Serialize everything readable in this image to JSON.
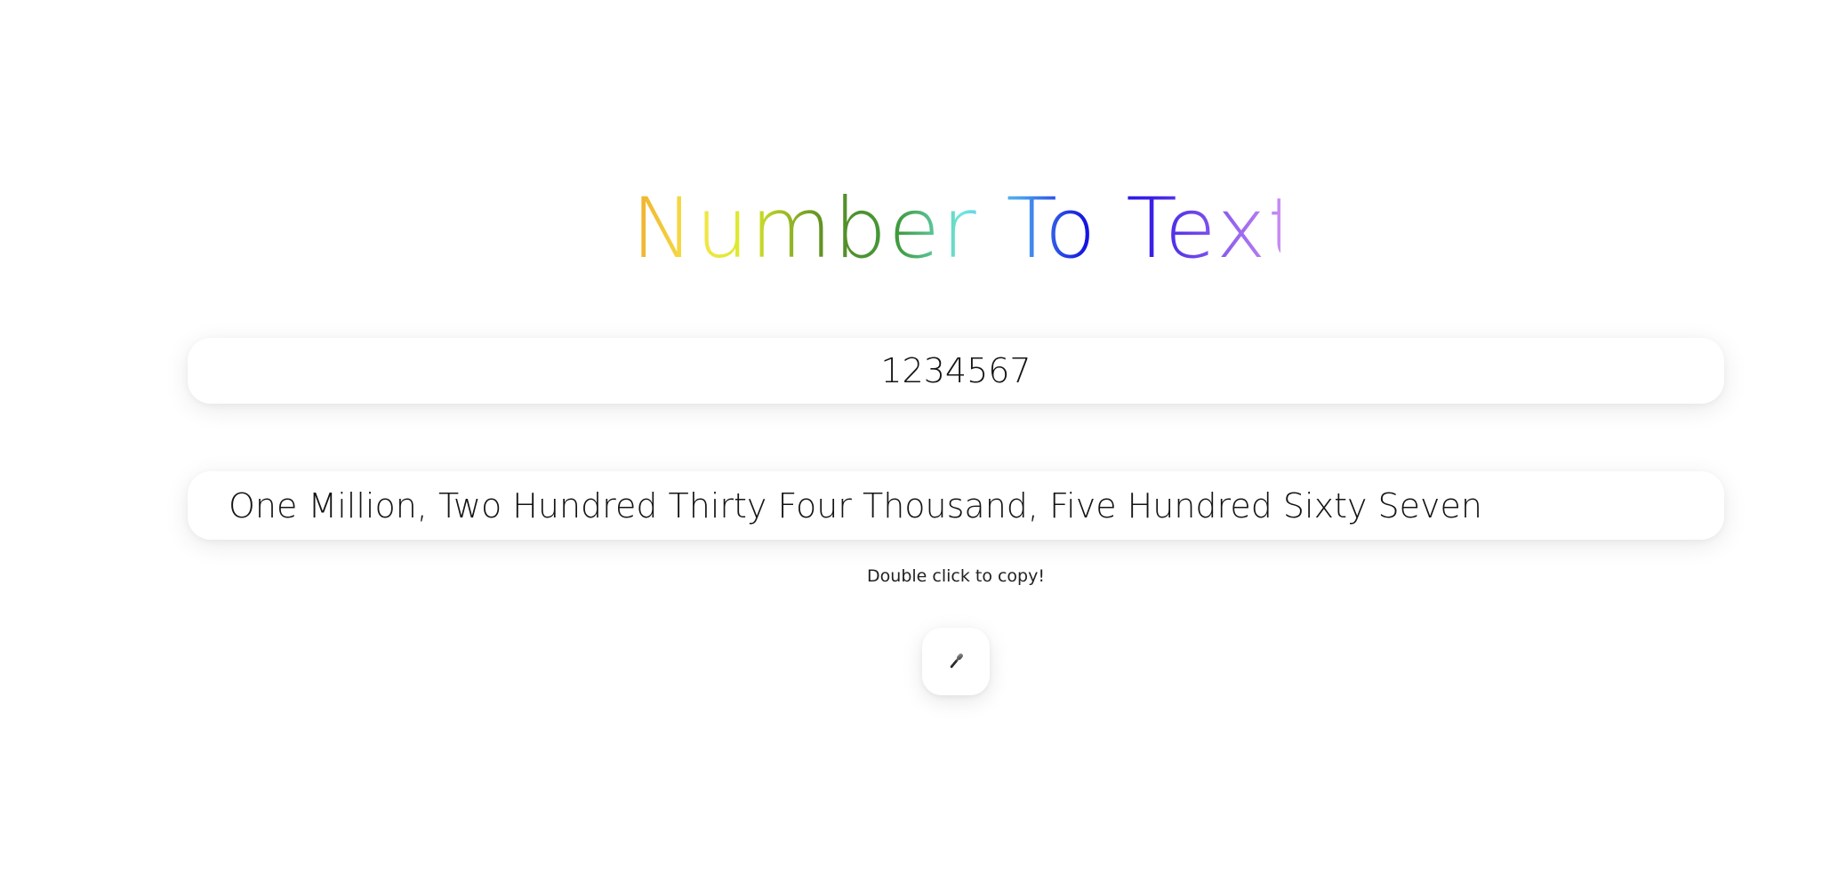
{
  "header": {
    "title": "Number To Text"
  },
  "number_input": {
    "value": "1234567"
  },
  "output": {
    "words": "One Million, Two Hundred Thirty Four Thousand, Five Hundred Sixty Seven",
    "hint": "Double click to copy!"
  },
  "mic_button": {
    "icon": "microphone-icon"
  },
  "colors": {
    "title_gradient": [
      "#f0ac2c",
      "#f5e64a",
      "#d9e82a",
      "#5a8c22",
      "#3f9a3e",
      "#6fe6e0",
      "#4aa0ee",
      "#1414e0",
      "#3a1fe6",
      "#c98cf3"
    ],
    "text": "#141414",
    "background": "#ffffff"
  }
}
